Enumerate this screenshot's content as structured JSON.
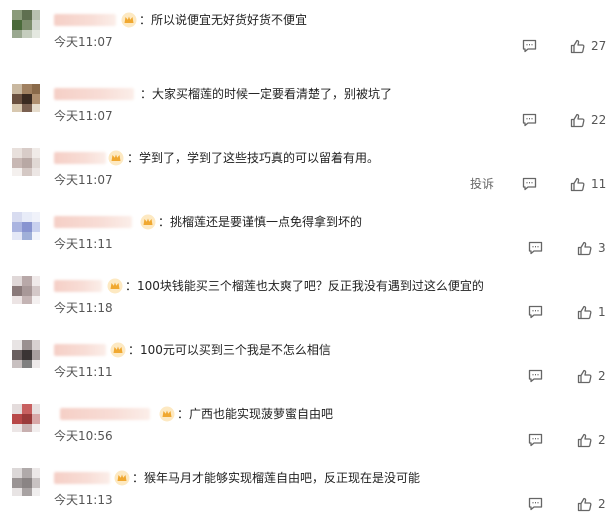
{
  "comments": [
    {
      "text": "：所以说便宜无好货好货不便宜",
      "time": "今天11:07",
      "likes": "27"
    },
    {
      "text": "：大家买榴莲的时候一定要看清楚了，别被坑了",
      "time": "今天11:07",
      "likes": "22"
    },
    {
      "text": "：学到了，学到了这些技巧真的可以留着有用。",
      "time": "今天11:07",
      "likes": "11",
      "report": "投诉"
    },
    {
      "text": "：挑榴莲还是要谨慎一点免得拿到坏的",
      "time": "今天11:11",
      "likes": "3"
    },
    {
      "text": "：100块钱能买三个榴莲也太爽了吧？反正我没有遇到过这么便宜的",
      "time": "今天11:18",
      "likes": "1"
    },
    {
      "text": "：100元可以买到三个我是不怎么相信",
      "time": "今天11:11",
      "likes": "2"
    },
    {
      "text": "：广西也能实现菠萝蜜自由吧",
      "time": "今天10:56",
      "likes": "2"
    },
    {
      "text": "：猴年马月才能够实现榴莲自由吧，反正现在是没可能",
      "time": "今天11:13",
      "likes": "2"
    }
  ],
  "colors": {
    "crown": "#f0a830",
    "blur": "#f5cfc6",
    "icon": "#666666"
  },
  "icons": {
    "comment": "comment-icon",
    "like": "thumbs-up-icon",
    "badge": "crown-icon"
  }
}
